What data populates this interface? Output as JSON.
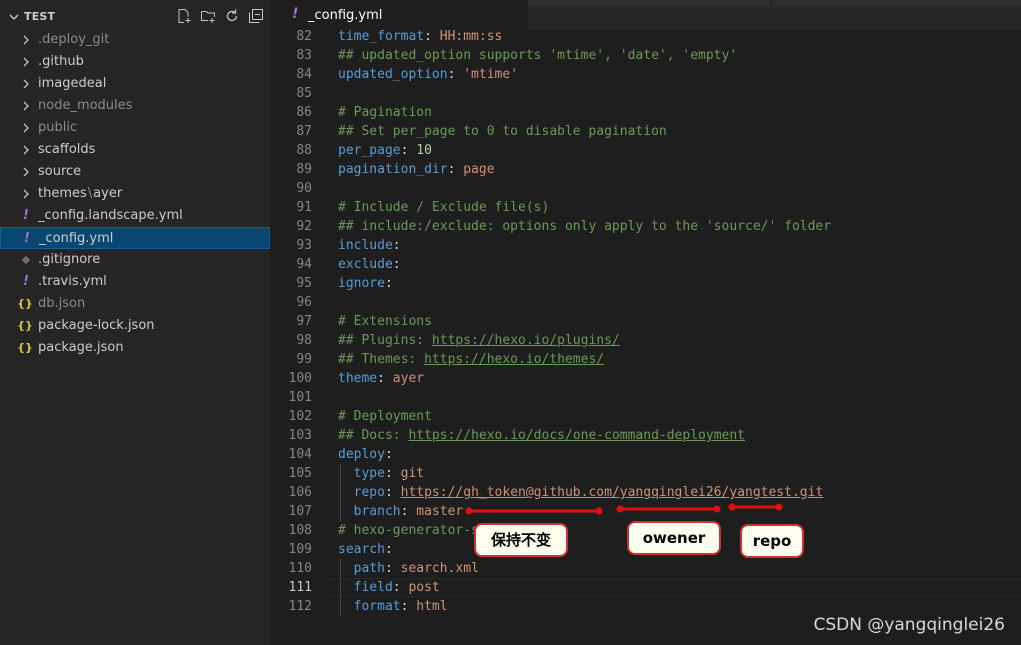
{
  "explorer": {
    "root_label": "TEST",
    "actions": [
      "new-file-icon",
      "new-folder-icon",
      "refresh-icon",
      "collapse-all-icon"
    ],
    "items": [
      {
        "type": "folder",
        "label": "deploy_git",
        "prefix": ".",
        "dim": true
      },
      {
        "type": "folder",
        "label": ".github",
        "dim": false
      },
      {
        "type": "folder",
        "label": "imagedeal",
        "dim": false
      },
      {
        "type": "folder",
        "label": "node_modules",
        "dim": true
      },
      {
        "type": "folder",
        "label": "public",
        "dim": true
      },
      {
        "type": "folder",
        "label": "scaffolds",
        "dim": false
      },
      {
        "type": "folder",
        "label": "source",
        "dim": false
      },
      {
        "type": "folder",
        "label": "themes",
        "label_sep": "\\",
        "label_tail": "ayer",
        "dim": false
      },
      {
        "type": "yml",
        "label": "_config.landscape.yml",
        "dim": false
      },
      {
        "type": "yml",
        "label": "_config.yml",
        "dim": false,
        "selected": true
      },
      {
        "type": "git",
        "label": ".gitignore",
        "dim": false
      },
      {
        "type": "yml",
        "label": ".travis.yml",
        "dim": false
      },
      {
        "type": "json",
        "label": "db.json",
        "dim": true
      },
      {
        "type": "json",
        "label": "package-lock.json",
        "dim": false
      },
      {
        "type": "json",
        "label": "package.json",
        "dim": false
      }
    ]
  },
  "tab": {
    "icon": "!",
    "label": "_config.yml"
  },
  "editor": {
    "current_line": 111,
    "lines": [
      {
        "n": 82,
        "t": [
          {
            "c": "k",
            "v": "time_format"
          },
          {
            "c": "p",
            "v": ": "
          },
          {
            "c": "s",
            "v": "HH:mm:ss"
          }
        ]
      },
      {
        "n": 83,
        "t": [
          {
            "c": "c",
            "v": "## updated_option supports 'mtime', 'date', 'empty'"
          }
        ]
      },
      {
        "n": 84,
        "t": [
          {
            "c": "k",
            "v": "updated_option"
          },
          {
            "c": "p",
            "v": ": "
          },
          {
            "c": "s",
            "v": "'mtime'"
          }
        ]
      },
      {
        "n": 85,
        "t": []
      },
      {
        "n": 86,
        "t": [
          {
            "c": "c",
            "v": "# Pagination"
          }
        ]
      },
      {
        "n": 87,
        "t": [
          {
            "c": "c",
            "v": "## Set per_page to 0 to disable pagination"
          }
        ]
      },
      {
        "n": 88,
        "t": [
          {
            "c": "k",
            "v": "per_page"
          },
          {
            "c": "p",
            "v": ": "
          },
          {
            "c": "n",
            "v": "10"
          }
        ]
      },
      {
        "n": 89,
        "t": [
          {
            "c": "k",
            "v": "pagination_dir"
          },
          {
            "c": "p",
            "v": ": "
          },
          {
            "c": "s",
            "v": "page"
          }
        ]
      },
      {
        "n": 90,
        "t": []
      },
      {
        "n": 91,
        "t": [
          {
            "c": "c",
            "v": "# Include / Exclude file(s)"
          }
        ]
      },
      {
        "n": 92,
        "t": [
          {
            "c": "c",
            "v": "## include:/exclude: options only apply to the 'source/' folder"
          }
        ]
      },
      {
        "n": 93,
        "t": [
          {
            "c": "k",
            "v": "include"
          },
          {
            "c": "p",
            "v": ":"
          }
        ]
      },
      {
        "n": 94,
        "t": [
          {
            "c": "k",
            "v": "exclude"
          },
          {
            "c": "p",
            "v": ":"
          }
        ]
      },
      {
        "n": 95,
        "t": [
          {
            "c": "k",
            "v": "ignore"
          },
          {
            "c": "p",
            "v": ":"
          }
        ]
      },
      {
        "n": 96,
        "t": []
      },
      {
        "n": 97,
        "t": [
          {
            "c": "c",
            "v": "# Extensions"
          }
        ]
      },
      {
        "n": 98,
        "t": [
          {
            "c": "c",
            "v": "## Plugins: "
          },
          {
            "c": "uc",
            "v": "https://hexo.io/plugins/"
          }
        ]
      },
      {
        "n": 99,
        "t": [
          {
            "c": "c",
            "v": "## Themes: "
          },
          {
            "c": "uc",
            "v": "https://hexo.io/themes/"
          }
        ]
      },
      {
        "n": 100,
        "t": [
          {
            "c": "k",
            "v": "theme"
          },
          {
            "c": "p",
            "v": ": "
          },
          {
            "c": "s",
            "v": "ayer"
          }
        ]
      },
      {
        "n": 101,
        "t": []
      },
      {
        "n": 102,
        "t": [
          {
            "c": "c",
            "v": "# Deployment"
          }
        ]
      },
      {
        "n": 103,
        "t": [
          {
            "c": "c",
            "v": "## Docs: "
          },
          {
            "c": "uc",
            "v": "https://hexo.io/docs/one-command-deployment"
          }
        ]
      },
      {
        "n": 104,
        "t": [
          {
            "c": "k",
            "v": "deploy"
          },
          {
            "c": "p",
            "v": ":"
          }
        ]
      },
      {
        "n": 105,
        "t": [
          {
            "c": "p",
            "v": "  "
          },
          {
            "c": "k",
            "v": "type"
          },
          {
            "c": "p",
            "v": ": "
          },
          {
            "c": "s",
            "v": "git"
          }
        ]
      },
      {
        "n": 106,
        "t": [
          {
            "c": "p",
            "v": "  "
          },
          {
            "c": "k",
            "v": "repo"
          },
          {
            "c": "p",
            "v": ": "
          },
          {
            "c": "u",
            "v": "https://gh_token@github.com/yangqinglei26/yangtest.git"
          }
        ]
      },
      {
        "n": 107,
        "t": [
          {
            "c": "p",
            "v": "  "
          },
          {
            "c": "k",
            "v": "branch"
          },
          {
            "c": "p",
            "v": ": "
          },
          {
            "c": "s",
            "v": "master"
          }
        ]
      },
      {
        "n": 108,
        "t": [
          {
            "c": "c",
            "v": "# hexo-generator-s"
          }
        ]
      },
      {
        "n": 109,
        "t": [
          {
            "c": "k",
            "v": "search"
          },
          {
            "c": "p",
            "v": ":"
          }
        ]
      },
      {
        "n": 110,
        "t": [
          {
            "c": "p",
            "v": "  "
          },
          {
            "c": "k",
            "v": "path"
          },
          {
            "c": "p",
            "v": ": "
          },
          {
            "c": "s",
            "v": "search.xml"
          }
        ]
      },
      {
        "n": 111,
        "t": [
          {
            "c": "p",
            "v": "  "
          },
          {
            "c": "k",
            "v": "field"
          },
          {
            "c": "p",
            "v": ": "
          },
          {
            "c": "s",
            "v": "post"
          }
        ]
      },
      {
        "n": 112,
        "t": [
          {
            "c": "p",
            "v": "  "
          },
          {
            "c": "k",
            "v": "format"
          },
          {
            "c": "p",
            "v": ": "
          },
          {
            "c": "s",
            "v": "html"
          }
        ]
      }
    ]
  },
  "annotations": {
    "keep": "保持不变",
    "owner": "owener",
    "repo": "repo",
    "line_color": "#e01010"
  },
  "watermark": "CSDN @yangqinglei26",
  "colors": {
    "sidebar_bg": "#252526",
    "editor_bg": "#1e1e1e",
    "selection": "#094771",
    "key": "#569cd6",
    "string": "#ce9178",
    "comment": "#6a9955",
    "number": "#b5cea8",
    "yml_icon": "#a074c4",
    "json_icon": "#cbcb41"
  }
}
